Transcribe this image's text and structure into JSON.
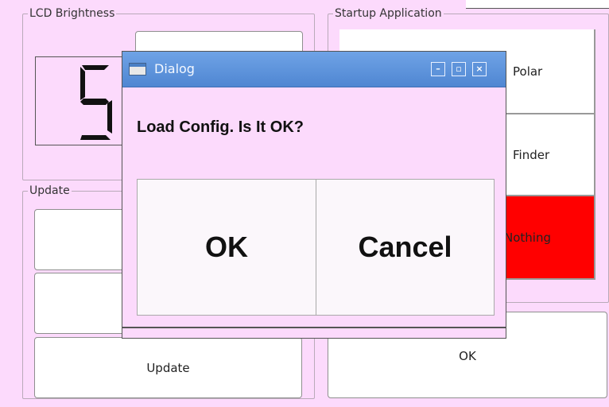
{
  "lcd_group": {
    "legend": "LCD Brightness",
    "digit": "5"
  },
  "startup_group": {
    "legend": "Startup Application",
    "items": [
      {
        "label": "Polar",
        "color": "#ffffff"
      },
      {
        "label": "Finder",
        "color": "#ffffff"
      },
      {
        "label": "Nothing",
        "color": "#ff0000"
      }
    ],
    "ok_label": "OK"
  },
  "update_group": {
    "legend": "Update",
    "update_label": "Update"
  },
  "dialog": {
    "title": "Dialog",
    "message": "Load Config. Is It OK?",
    "ok_label": "OK",
    "cancel_label": "Cancel",
    "title_buttons": [
      "–",
      "▫",
      "×"
    ],
    "titlebar_color": "#5b8fda"
  }
}
